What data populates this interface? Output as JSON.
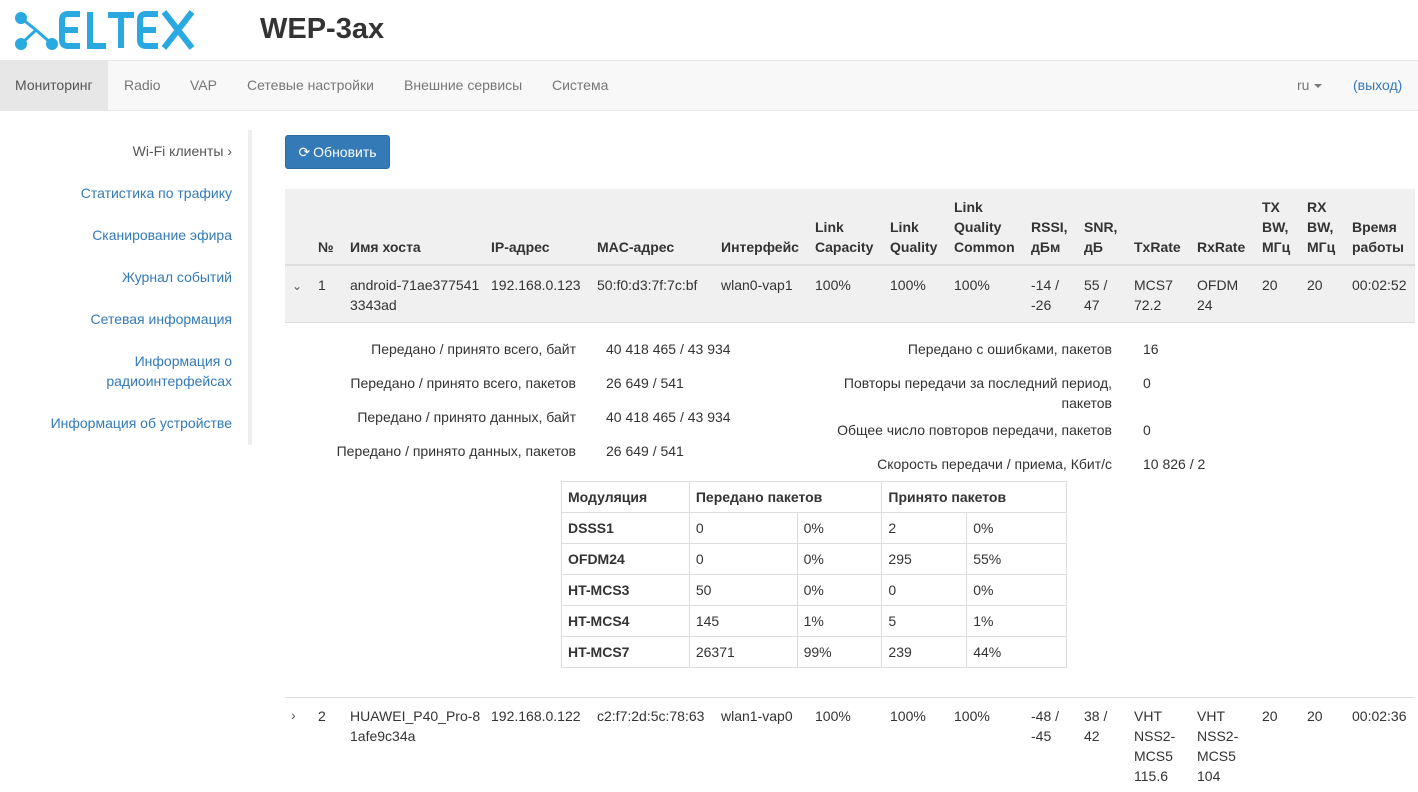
{
  "brand": {
    "logo_text": "ELTEX",
    "product": "WEP-3ax",
    "accent": "#2aa8e0"
  },
  "nav": {
    "items": [
      {
        "label": "Мониторинг",
        "active": true
      },
      {
        "label": "Radio"
      },
      {
        "label": "VAP"
      },
      {
        "label": "Сетевые настройки"
      },
      {
        "label": "Внешние сервисы"
      },
      {
        "label": "Система"
      }
    ],
    "lang": "ru",
    "logout": "(выход)"
  },
  "sidebar": {
    "items": [
      {
        "label": "Wi-Fi клиенты ›",
        "active": true
      },
      {
        "label": "Статистика по трафику"
      },
      {
        "label": "Сканирование эфира"
      },
      {
        "label": "Журнал событий"
      },
      {
        "label": "Сетевая информация"
      },
      {
        "label": "Информация о радиоинтерфейсах"
      },
      {
        "label": "Информация об устройстве"
      }
    ]
  },
  "refresh_button": {
    "label": "Обновить",
    "icon": "refresh-icon"
  },
  "table": {
    "headers": {
      "num": "№",
      "host": "Имя хоста",
      "ip": "IP-адрес",
      "mac": "MAC-адрес",
      "iface": "Интерфейс",
      "link_capacity": "Link Capacity",
      "link_quality": "Link Quality",
      "lq_common": "Link Quality Common",
      "rssi": "RSSI, дБм",
      "snr": "SNR, дБ",
      "txrate": "TxRate",
      "rxrate": "RxRate",
      "txbw": "TX BW, МГц",
      "rxbw": "RX BW, МГц",
      "uptime": "Время работы"
    },
    "rows": [
      {
        "expanded": true,
        "num": "1",
        "host": "android-71ae3775413343ad",
        "ip": "192.168.0.123",
        "mac": "50:f0:d3:7f:7c:bf",
        "iface": "wlan0-vap1",
        "link_capacity": "100%",
        "link_quality": "100%",
        "lq_common": "100%",
        "rssi": "-14 / -26",
        "snr": "55 / 47",
        "txrate": "MCS7 72.2",
        "rxrate": "OFDM 24",
        "txbw": "20",
        "rxbw": "20",
        "uptime": "00:02:52"
      },
      {
        "expanded": false,
        "num": "2",
        "host": "HUAWEI_P40_Pro-81afe9c34a",
        "ip": "192.168.0.122",
        "mac": "c2:f7:2d:5c:78:63",
        "iface": "wlan1-vap0",
        "link_capacity": "100%",
        "link_quality": "100%",
        "lq_common": "100%",
        "rssi": "-48 / -45",
        "snr": "38 / 42",
        "txrate": "VHT NSS2-MCS5 115.6",
        "rxrate": "VHT NSS2-MCS5 104",
        "txbw": "20",
        "rxbw": "20",
        "uptime": "00:02:36"
      }
    ]
  },
  "details": {
    "left": [
      {
        "label": "Передано / принято всего, байт",
        "value": "40 418 465 / 43 934"
      },
      {
        "label": "Передано / принято всего, пакетов",
        "value": "26 649 / 541"
      },
      {
        "label": "Передано / принято данных, байт",
        "value": "40 418 465 / 43 934"
      },
      {
        "label": "Передано / принято данных, пакетов",
        "value": "26 649 / 541"
      }
    ],
    "right": [
      {
        "label": "Передано с ошибками, пакетов",
        "value": "16"
      },
      {
        "label": "Повторы передачи за последний период, пакетов",
        "value": "0"
      },
      {
        "label": "Общее число повторов передачи, пакетов",
        "value": "0"
      },
      {
        "label": "Скорость передачи / приема, Кбит/с",
        "value": "10 826 / 2"
      }
    ]
  },
  "modulation": {
    "headers": {
      "mod": "Модуляция",
      "tx": "Передано пакетов",
      "rx": "Принято пакетов"
    },
    "rows": [
      {
        "mod": "DSSS1",
        "tx": "0",
        "tx_pct": "0%",
        "rx": "2",
        "rx_pct": "0%"
      },
      {
        "mod": "OFDM24",
        "tx": "0",
        "tx_pct": "0%",
        "rx": "295",
        "rx_pct": "55%"
      },
      {
        "mod": "HT-MCS3",
        "tx": "50",
        "tx_pct": "0%",
        "rx": "0",
        "rx_pct": "0%"
      },
      {
        "mod": "HT-MCS4",
        "tx": "145",
        "tx_pct": "1%",
        "rx": "5",
        "rx_pct": "1%"
      },
      {
        "mod": "HT-MCS7",
        "tx": "26371",
        "tx_pct": "99%",
        "rx": "239",
        "rx_pct": "44%"
      }
    ]
  }
}
